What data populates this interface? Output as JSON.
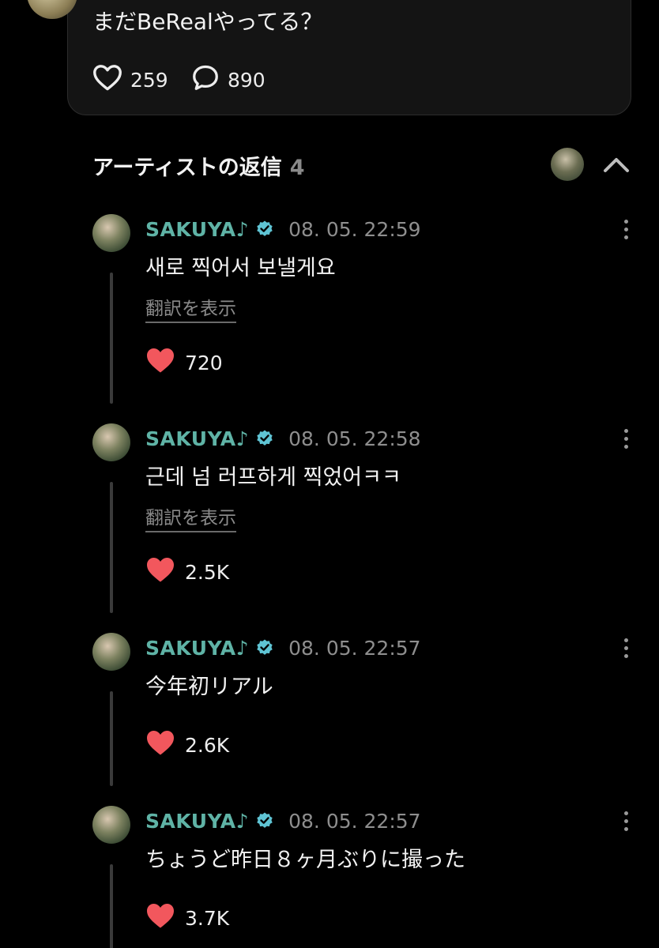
{
  "post": {
    "text": "まだBeRealやってる？",
    "likes": "259",
    "comments": "890"
  },
  "section": {
    "title": "アーティストの返信",
    "count": "4"
  },
  "replies": [
    {
      "name": "SAKUYA♪",
      "time": "08. 05. 22:59",
      "text": "새로 찍어서 보낼게요",
      "translate": "翻訳を表示",
      "likes": "720"
    },
    {
      "name": "SAKUYA♪",
      "time": "08. 05. 22:58",
      "text": "근데 넘 러프하게 찍었어ㅋㅋ",
      "translate": "翻訳を表示",
      "likes": "2.5K"
    },
    {
      "name": "SAKUYA♪",
      "time": "08. 05. 22:57",
      "text": "今年初リアル",
      "likes": "2.6K"
    },
    {
      "name": "SAKUYA♪",
      "time": "08. 05. 22:57",
      "text": "ちょうど昨日８ヶ月ぶりに撮った",
      "likes": "3.7K"
    }
  ],
  "colors": {
    "accent_name": "#5fb3a6",
    "verified": "#5fc4d4",
    "heart": "#f2575d",
    "background": "#000000"
  },
  "icons": {
    "like": "heart-outline-icon",
    "comment": "speech-bubble-icon",
    "liked": "heart-filled-icon",
    "verified": "verified-badge-icon",
    "more": "more-vertical-icon",
    "collapse": "chevron-up-icon"
  }
}
